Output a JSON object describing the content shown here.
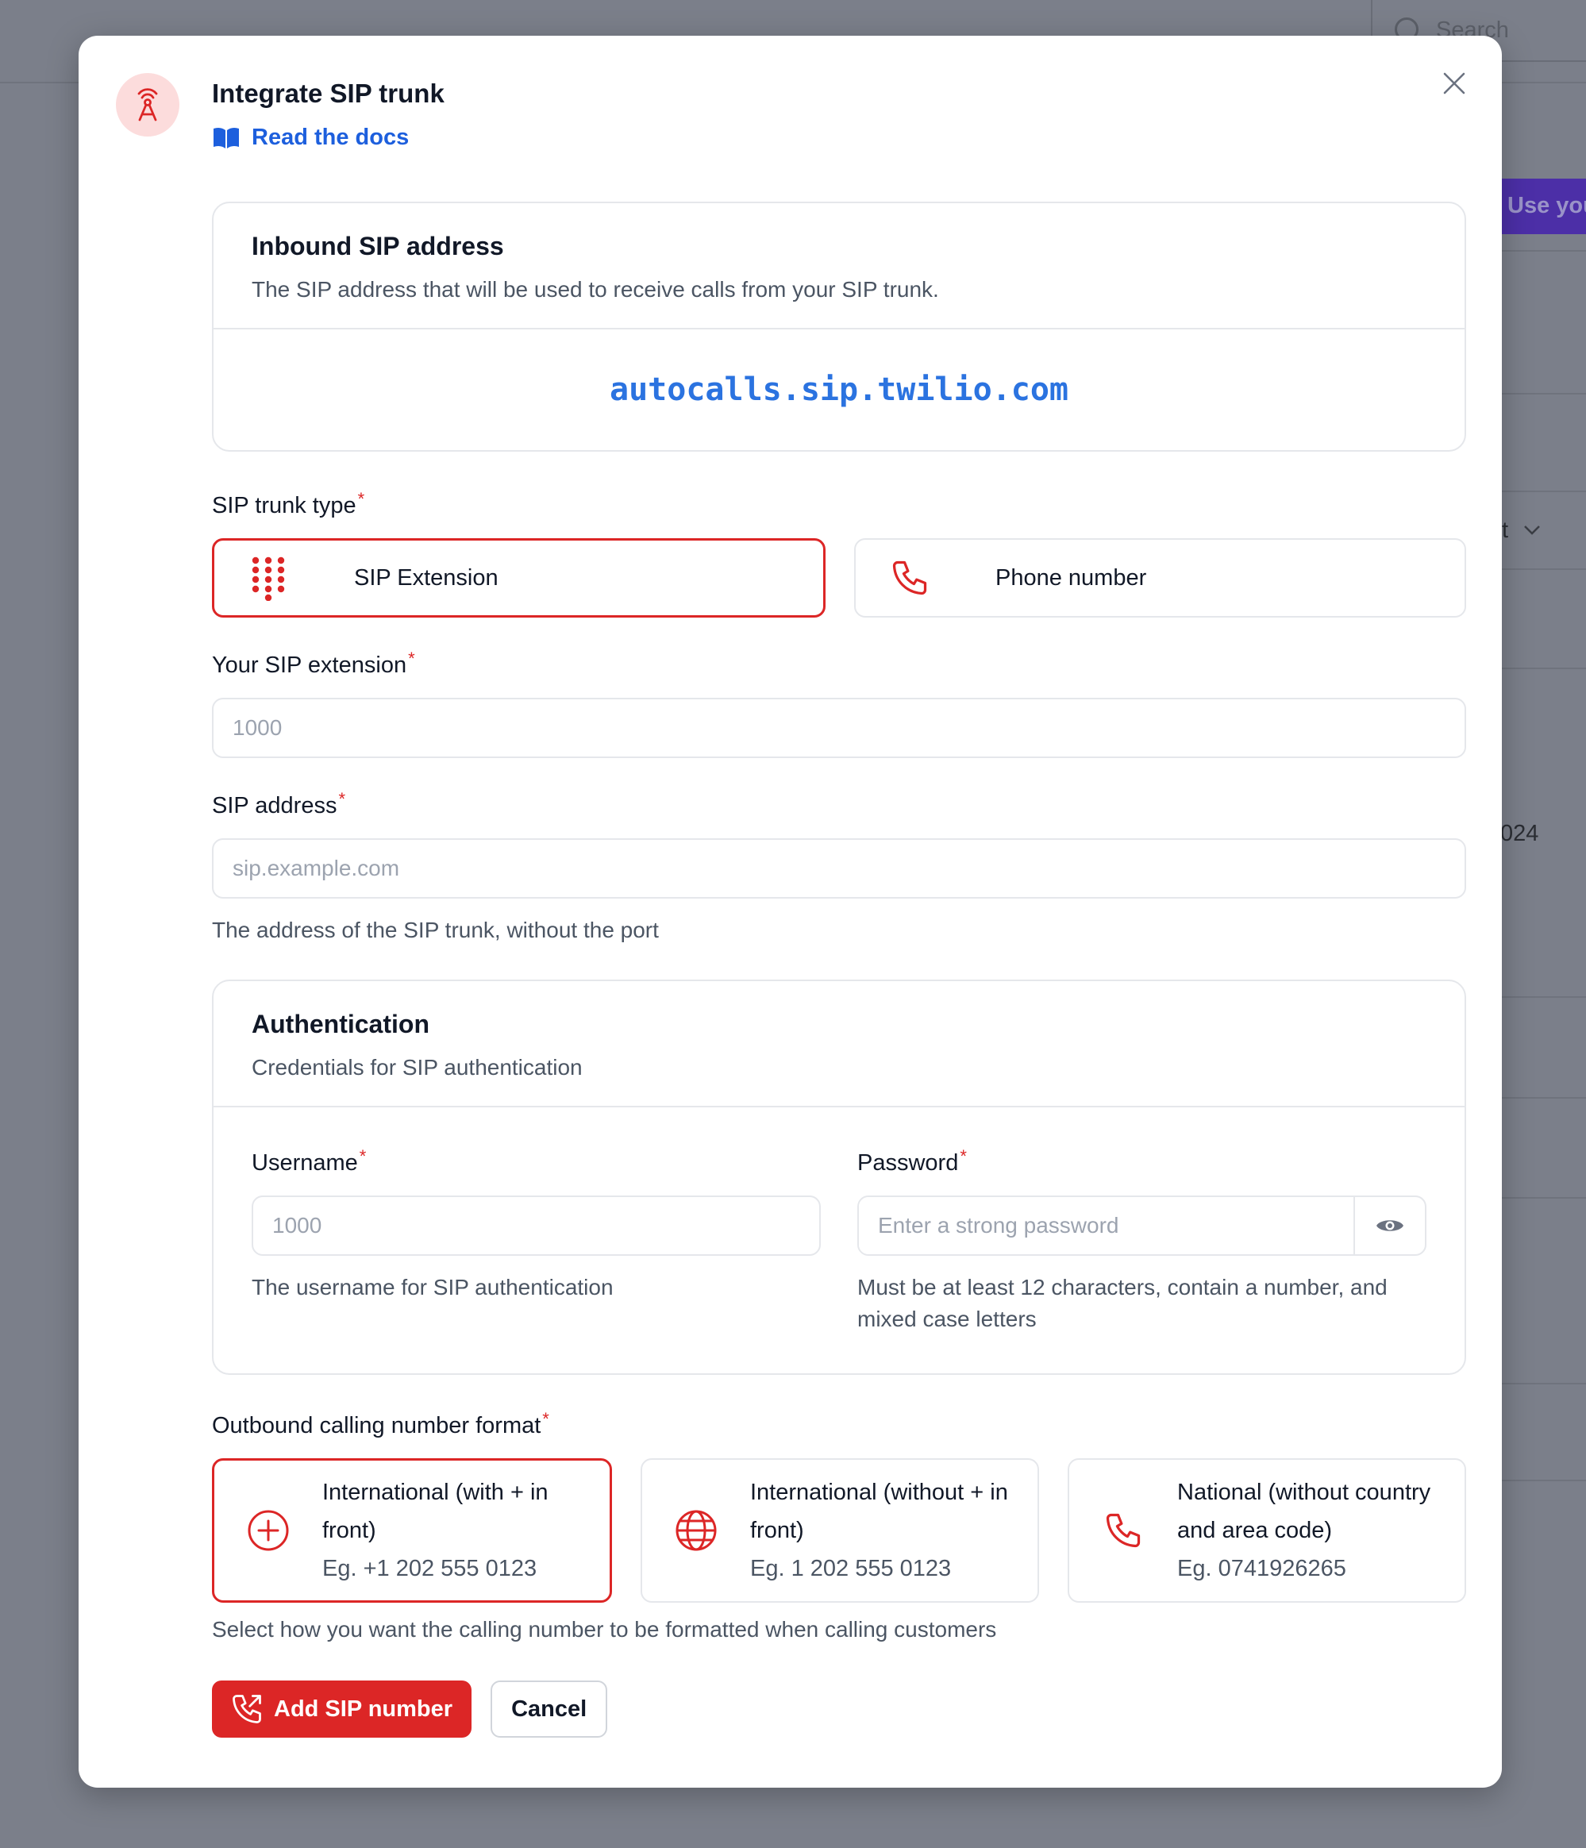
{
  "background": {
    "search_placeholder": "Search",
    "use_button_label": "Use you",
    "dropdown_fragment": "t",
    "date_fragment": "024"
  },
  "modal": {
    "title": "Integrate SIP trunk",
    "docs_link": "Read the docs",
    "inbound": {
      "title": "Inbound SIP address",
      "subtitle": "The SIP address that will be used to receive calls from your SIP trunk.",
      "address": "autocalls.sip.twilio.com"
    },
    "trunk_type": {
      "label": "SIP trunk type",
      "required": "*",
      "options": [
        {
          "label": "SIP Extension",
          "icon": "dialpad-icon",
          "selected": true
        },
        {
          "label": "Phone number",
          "icon": "phone-icon",
          "selected": false
        }
      ]
    },
    "extension": {
      "label": "Your SIP extension",
      "required": "*",
      "placeholder": "1000",
      "value": ""
    },
    "sip_address": {
      "label": "SIP address",
      "required": "*",
      "placeholder": "sip.example.com",
      "value": "",
      "hint": "The address of the SIP trunk, without the port"
    },
    "authentication": {
      "title": "Authentication",
      "subtitle": "Credentials for SIP authentication",
      "username": {
        "label": "Username",
        "required": "*",
        "placeholder": "1000",
        "value": "",
        "hint": "The username for SIP authentication"
      },
      "password": {
        "label": "Password",
        "required": "*",
        "placeholder": "Enter a strong password",
        "value": "",
        "hint": "Must be at least 12 characters, contain a number, and mixed case letters"
      }
    },
    "outbound_format": {
      "label": "Outbound calling number format",
      "required": "*",
      "options": [
        {
          "title": "International (with + in front)",
          "example": "Eg. +1 202 555 0123",
          "icon": "plus-circle-icon",
          "selected": true
        },
        {
          "title": "International (without + in front)",
          "example": "Eg. 1 202 555 0123",
          "icon": "globe-icon",
          "selected": false
        },
        {
          "title": "National (without country and area code)",
          "example": "Eg. 0741926265",
          "icon": "phone-icon",
          "selected": false
        }
      ],
      "hint": "Select how you want the calling number to be formatted when calling customers"
    },
    "actions": {
      "submit": "Add SIP number",
      "cancel": "Cancel"
    }
  },
  "colors": {
    "accent": "#dc2626",
    "link": "#1d5fdd",
    "sip_address": "#2b73e0",
    "overlay": "#7b7f8a"
  }
}
